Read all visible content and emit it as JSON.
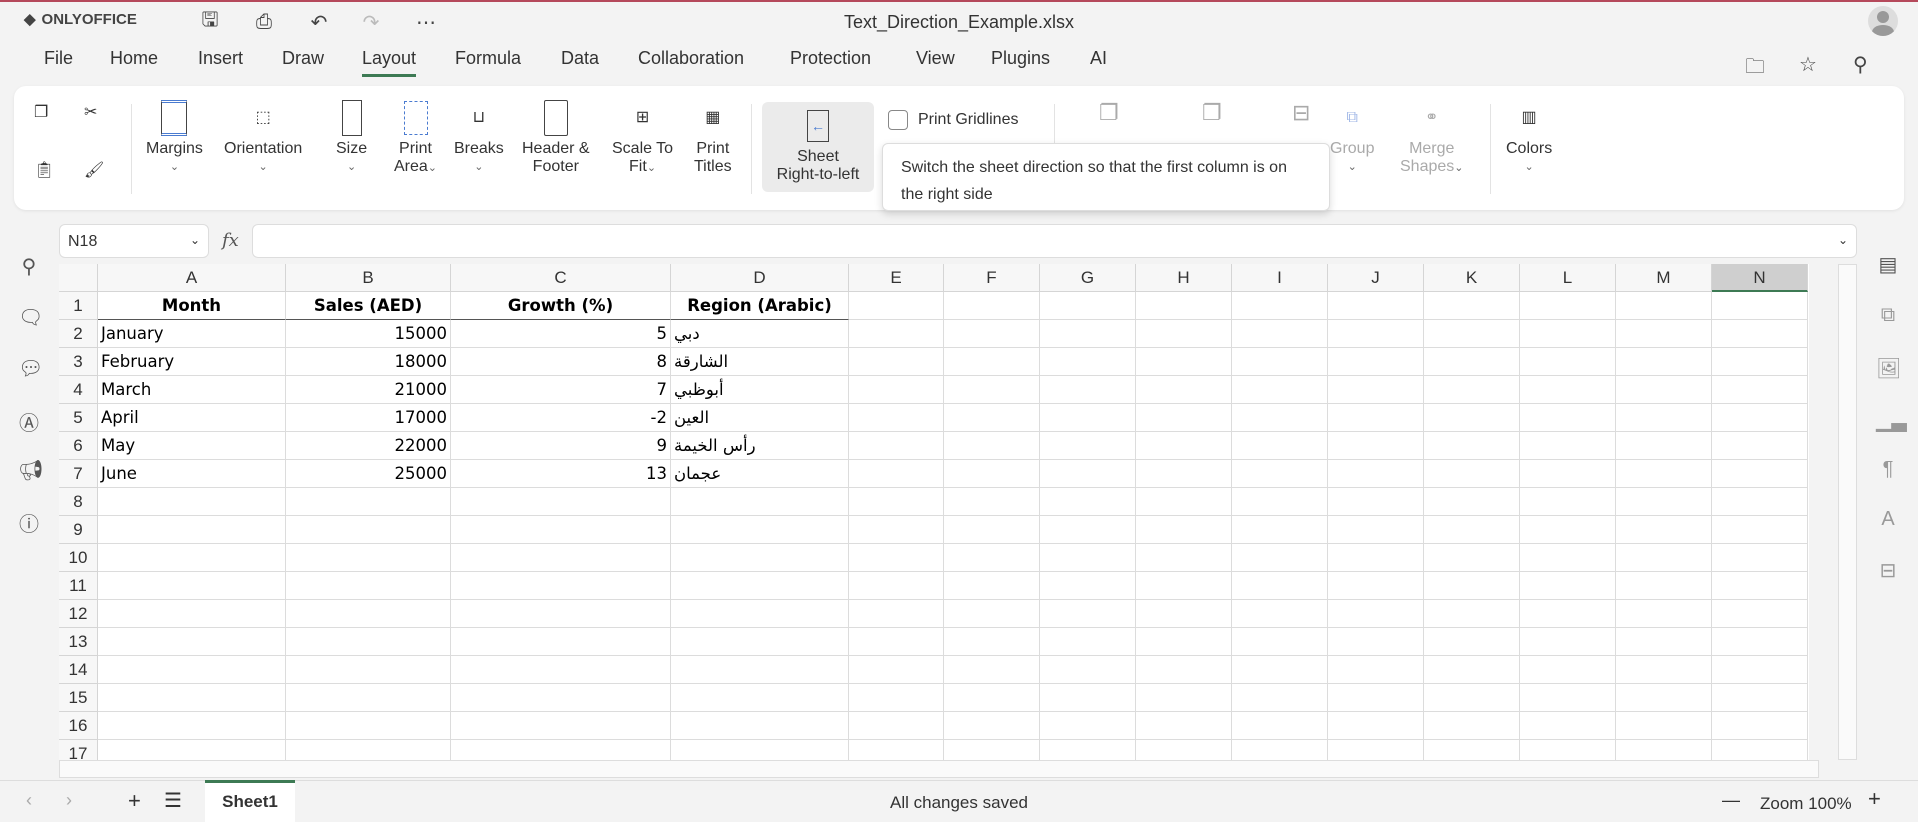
{
  "app": {
    "logo": "ONLYOFFICE",
    "title": "Text_Direction_Example.xlsx"
  },
  "menu": [
    "File",
    "Home",
    "Insert",
    "Draw",
    "Layout",
    "Formula",
    "Data",
    "Collaboration",
    "Protection",
    "View",
    "Plugins",
    "AI"
  ],
  "active_menu": "Layout",
  "ribbon": {
    "margins": "Margins",
    "orientation": "Orientation",
    "size": "Size",
    "print_area_1": "Print",
    "print_area_2": "Area",
    "breaks": "Breaks",
    "header_1": "Header &",
    "header_2": "Footer",
    "scale_1": "Scale To",
    "scale_2": "Fit",
    "titles_1": "Print",
    "titles_2": "Titles",
    "rtl_1": "Sheet",
    "rtl_2": "Right-to-left",
    "gridlines": "Print Gridlines",
    "group": "Group",
    "merge_1": "Merge",
    "merge_2": "Shapes",
    "colors": "Colors"
  },
  "tooltip": "Switch the sheet direction so that the first column is on the right side",
  "namebox": "N18",
  "fx": "fx",
  "columns": [
    "A",
    "B",
    "C",
    "D",
    "E",
    "F",
    "G",
    "H",
    "I",
    "J",
    "K",
    "L",
    "M",
    "N"
  ],
  "selected_column": "N",
  "rows": [
    [
      "Month",
      "Sales (AED)",
      "Growth (%)",
      "Region (Arabic)"
    ],
    [
      "January",
      "15000",
      "5",
      "دبي"
    ],
    [
      "February",
      "18000",
      "8",
      "الشارقة"
    ],
    [
      "March",
      "21000",
      "7",
      "أبوظبي"
    ],
    [
      "April",
      "17000",
      "-2",
      "العين"
    ],
    [
      "May",
      "22000",
      "9",
      "رأس الخيمة"
    ],
    [
      "June",
      "25000",
      "13",
      "عجمان"
    ]
  ],
  "row_count": 17,
  "sheet_tab": "Sheet1",
  "status": "All changes saved",
  "zoom": "Zoom 100%",
  "accent": "#3d7a54"
}
